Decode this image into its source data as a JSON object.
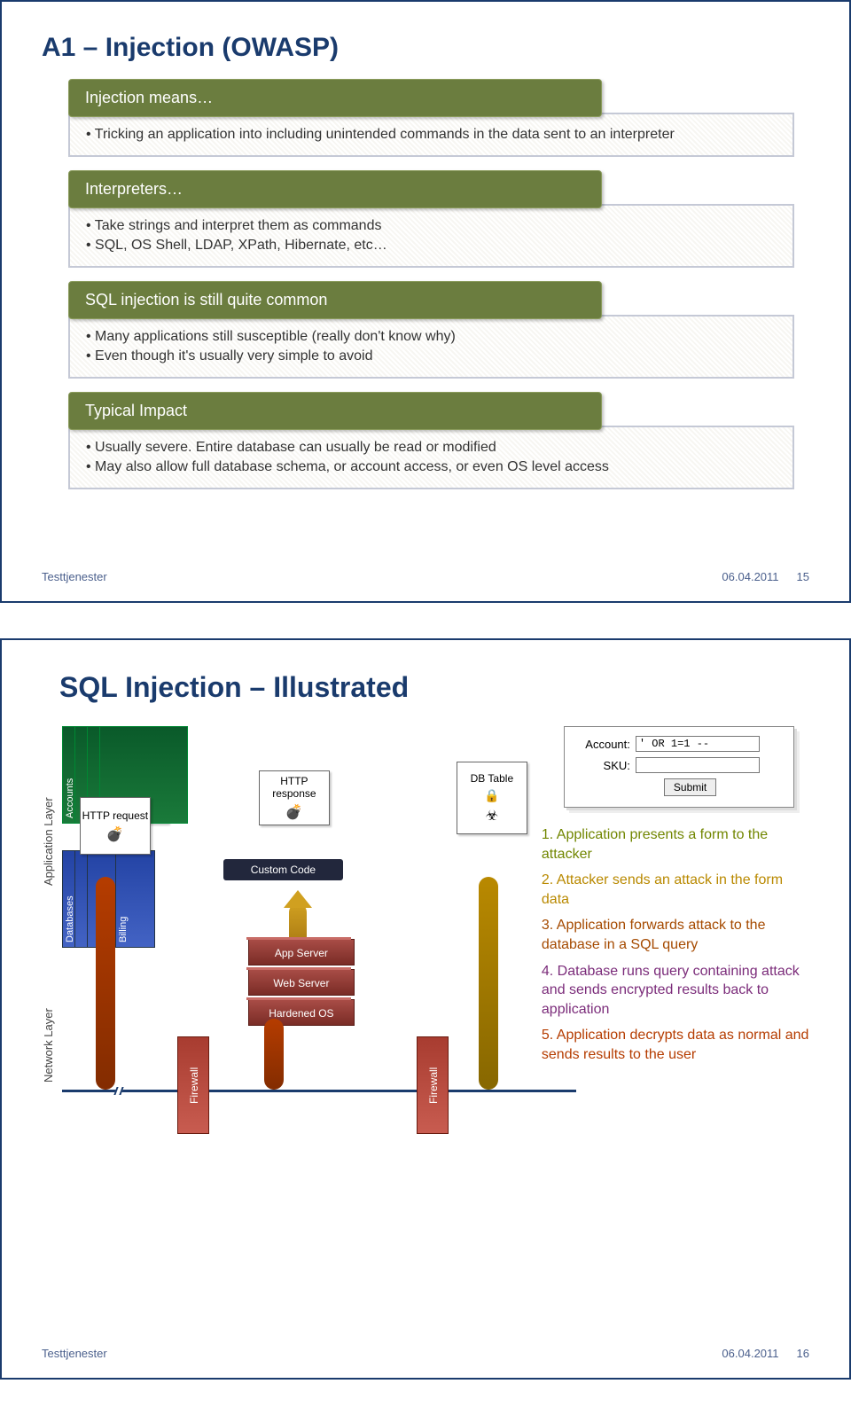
{
  "page1": {
    "title": "A1 – Injection (OWASP)",
    "sections": [
      {
        "header": "Injection means…",
        "bullets": [
          "Tricking an application into including unintended commands in the data sent to an interpreter"
        ]
      },
      {
        "header": "Interpreters…",
        "bullets": [
          "Take strings and interpret them as commands",
          "SQL, OS Shell, LDAP, XPath, Hibernate, etc…"
        ]
      },
      {
        "header": "SQL injection is still quite common",
        "bullets": [
          "Many applications still susceptible (really don't know why)",
          "Even though it's usually very simple to avoid"
        ]
      },
      {
        "header": "Typical Impact",
        "bullets": [
          "Usually severe. Entire database can usually be read or modified",
          "May also allow full database schema, or account access, or even OS level access"
        ]
      }
    ],
    "footer_left": "Testtjenester",
    "footer_date": "06.04.2011",
    "footer_page": "15"
  },
  "page2": {
    "title": "SQL Injection – Illustrated",
    "layer_labels": {
      "app": "Application Layer",
      "net": "Network Layer"
    },
    "diagram": {
      "http_request": "HTTP request",
      "http_response": "HTTP response",
      "accounts": "Accounts",
      "custom_code": "Custom Code",
      "app_server": "App Server",
      "web_server": "Web Server",
      "hardened_os": "Hardened OS",
      "firewall": "Firewall",
      "databases": "Databases",
      "billing": "Billing",
      "db_table": "DB Table"
    },
    "form": {
      "account_label": "Account:",
      "sku_label": "SKU:",
      "account_value": "' OR 1=1 --",
      "sku_value": "",
      "submit": "Submit"
    },
    "steps": [
      "1. Application presents a form to the attacker",
      "2. Attacker sends an attack in the form data",
      "3. Application forwards attack to the database in a SQL query",
      "4. Database runs query containing attack and sends encrypted results back to application",
      "5. Application decrypts data as normal and sends results to the user"
    ],
    "footer_left": "Testtjenester",
    "footer_date": "06.04.2011",
    "footer_page": "16"
  }
}
